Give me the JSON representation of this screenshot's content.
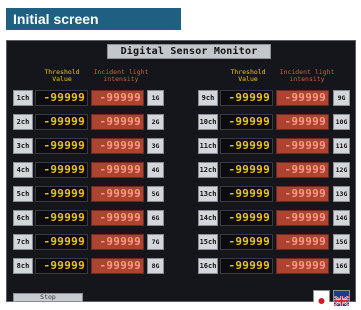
{
  "caption": "Initial screen",
  "title": "Digital Sensor Monitor",
  "headers": {
    "threshold_line1": "Threshold",
    "threshold_line2": "Value",
    "intensity_line1": "Incident light",
    "intensity_line2": "intensity"
  },
  "left_rows": [
    {
      "ch": "1ch",
      "value": "-99999",
      "level": "-99999",
      "g": "1G"
    },
    {
      "ch": "2ch",
      "value": "-99999",
      "level": "-99999",
      "g": "2G"
    },
    {
      "ch": "3ch",
      "value": "-99999",
      "level": "-99999",
      "g": "3G"
    },
    {
      "ch": "4ch",
      "value": "-99999",
      "level": "-99999",
      "g": "4G"
    },
    {
      "ch": "5ch",
      "value": "-99999",
      "level": "-99999",
      "g": "5G"
    },
    {
      "ch": "6ch",
      "value": "-99999",
      "level": "-99999",
      "g": "6G"
    },
    {
      "ch": "7ch",
      "value": "-99999",
      "level": "-99999",
      "g": "7G"
    },
    {
      "ch": "8ch",
      "value": "-99999",
      "level": "-99999",
      "g": "8G"
    }
  ],
  "right_rows": [
    {
      "ch": "9ch",
      "value": "-99999",
      "level": "-99999",
      "g": "9G"
    },
    {
      "ch": "10ch",
      "value": "-99999",
      "level": "-99999",
      "g": "10G"
    },
    {
      "ch": "11ch",
      "value": "-99999",
      "level": "-99999",
      "g": "11G"
    },
    {
      "ch": "12ch",
      "value": "-99999",
      "level": "-99999",
      "g": "12G"
    },
    {
      "ch": "13ch",
      "value": "-99999",
      "level": "-99999",
      "g": "13G"
    },
    {
      "ch": "14ch",
      "value": "-99999",
      "level": "-99999",
      "g": "14G"
    },
    {
      "ch": "15ch",
      "value": "-99999",
      "level": "-99999",
      "g": "15G"
    },
    {
      "ch": "16ch",
      "value": "-99999",
      "level": "-99999",
      "g": "16G"
    }
  ],
  "stop_label": "Stop",
  "flags": [
    {
      "name": "japan-flag-icon"
    },
    {
      "name": "uk-flag-icon"
    }
  ],
  "colors": {
    "value": "#f2c200",
    "level_bg": "#ad4331",
    "panel": "#14161c",
    "caption_bg": "#1f5f82"
  }
}
